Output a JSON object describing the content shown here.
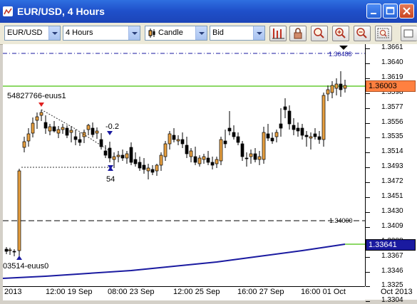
{
  "window": {
    "title": "EUR/USD, 4 Hours"
  },
  "toolbar": {
    "instrument": "EUR/USD",
    "period": "4 Hours",
    "chart_type": "Candle",
    "price_type": "Bid"
  },
  "chart": {
    "price_ticks": [
      "1.3661",
      "1.3640",
      "1.3619",
      "1.3598",
      "1.3577",
      "1.3556",
      "1.3535",
      "1.3514",
      "1.3493",
      "1.3472",
      "1.3451",
      "1.3430",
      "1.3409",
      "1.3388",
      "1.3367",
      "1.3346",
      "1.3325",
      "1.3304"
    ],
    "current_price": "1.36003",
    "ma_price": "1.33641",
    "top_line_label": "1.36488",
    "level_line_label": "1.34000",
    "order_label_top": "54827766-euus1",
    "order_label_bottom": "03514-euus0",
    "delta_value": "-0.2",
    "pips_value": "54",
    "time_labels": [
      "2013",
      "12:00 19 Sep",
      "08:00 23 Sep",
      "12:00 25 Sep",
      "16:00 27 Sep",
      "16:00 01 Oct",
      "Oct 2013"
    ],
    "colors": {
      "bull": "#e8a040",
      "line_green": "#66cc33",
      "ma_line": "#1a1aa0",
      "current_tag": "#ff8040"
    }
  }
}
